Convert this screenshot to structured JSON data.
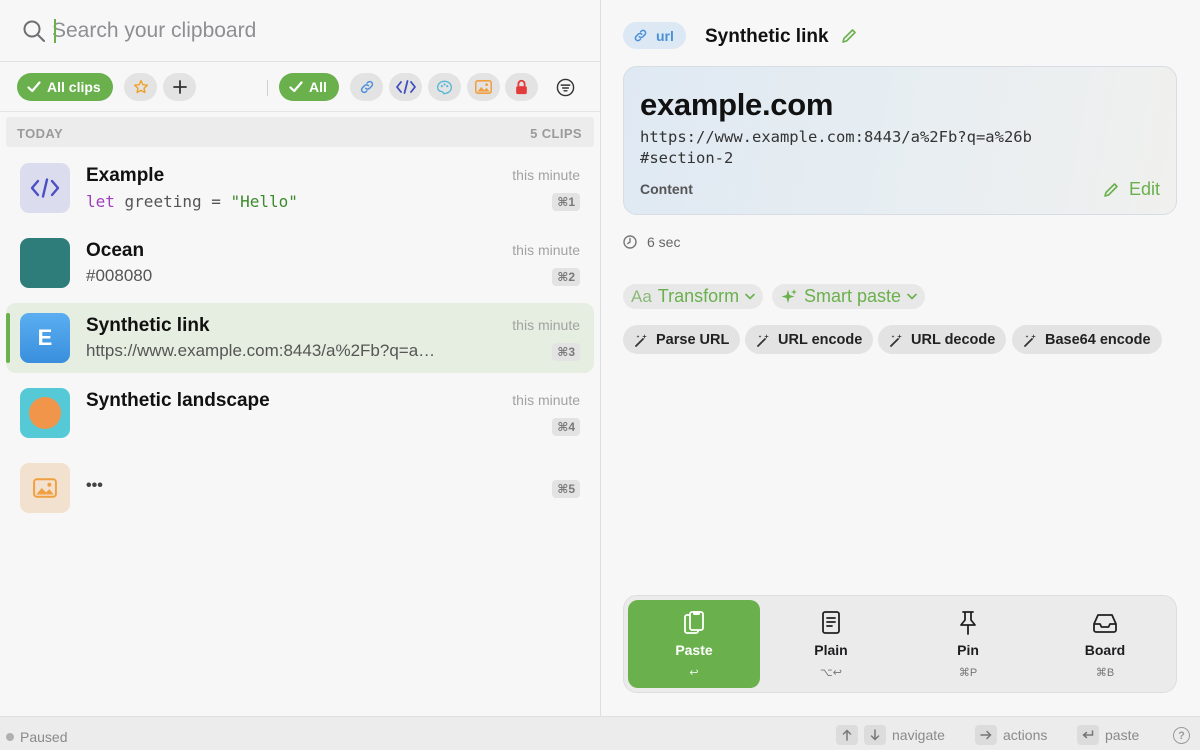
{
  "search": {
    "placeholder": "Search your clipboard"
  },
  "filters": {
    "all_clips_label": "All clips",
    "all_label": "All",
    "icons": [
      "star-icon",
      "plus-icon",
      "link-icon",
      "code-icon",
      "palette-icon",
      "image-icon",
      "lock-icon",
      "filter-icon"
    ],
    "accent": "#6ab04c"
  },
  "section": {
    "label": "TODAY",
    "count": "5 CLIPS"
  },
  "clips": [
    {
      "title": "Example",
      "code_kw": "let",
      "code_mid": " greeting = ",
      "code_str": "\"Hello\"",
      "time": "this minute",
      "shortcut": "⌘1",
      "thumb_color": "#dcdcef"
    },
    {
      "title": "Ocean",
      "subtitle": "#008080",
      "time": "this minute",
      "shortcut": "⌘2",
      "thumb_color": "#2f7d7a"
    },
    {
      "title": "Synthetic link",
      "subtitle": "https://www.example.com:8443/a%2Fb?q=a%26b#section-2",
      "thumb_letter": "E",
      "time": "this minute",
      "shortcut": "⌘3",
      "thumb_color": "#4a9ee8"
    },
    {
      "title": "Synthetic landscape",
      "time": "this minute",
      "shortcut": "⌘4",
      "thumb_color": "#56c9d6"
    },
    {
      "title": "•••",
      "shortcut": "⌘5",
      "thumb_color": "#f2e1cf"
    }
  ],
  "detail": {
    "type_badge": "url",
    "title": "Synthetic link",
    "domain": "example.com",
    "url": "https://www.example.com:8443/a%2Fb?q=a%26b#section-2",
    "content_label": "Content",
    "edit_label": "Edit",
    "age": "6 sec",
    "transform_prefix": "Aa",
    "transform_label": "Transform",
    "smart_paste_label": "Smart paste",
    "transforms": [
      "Parse URL",
      "URL encode",
      "URL decode",
      "Base64 encode"
    ]
  },
  "actions": [
    {
      "label": "Paste",
      "key": "↩"
    },
    {
      "label": "Plain",
      "key": "⌥↩"
    },
    {
      "label": "Pin",
      "key": "⌘P"
    },
    {
      "label": "Board",
      "key": "⌘B"
    }
  ],
  "status": {
    "paused": "Paused",
    "navigate": "navigate",
    "actions": "actions",
    "paste": "paste",
    "help": "?"
  }
}
